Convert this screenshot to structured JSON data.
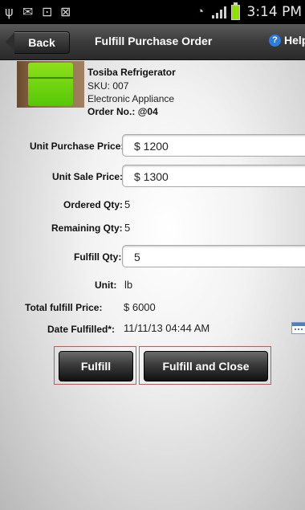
{
  "status_bar": {
    "time": "3:14 PM",
    "icons": [
      "usb-icon",
      "mail-icon",
      "bag-icon",
      "bag-check-icon",
      "wifi-icon",
      "signal-icon",
      "battery-icon"
    ]
  },
  "header": {
    "back_label": "Back",
    "title": "Fulfill Purchase Order",
    "help_label": "Help"
  },
  "product": {
    "name": "Tosiba Refrigerator",
    "sku": "SKU:  007",
    "category": "Electronic  Appliance",
    "order_label": "Order No.:",
    "order_value": "@04"
  },
  "form": {
    "unit_purchase_price_label": "Unit Purchase Price:",
    "unit_purchase_price_value": "$ 1200",
    "unit_sale_price_label": "Unit Sale Price:",
    "unit_sale_price_value": "$ 1300",
    "ordered_qty_label": "Ordered Qty:",
    "ordered_qty_value": "5",
    "remaining_qty_label": "Remaining Qty:",
    "remaining_qty_value": "5",
    "fulfill_qty_label": "Fulfill Qty:",
    "fulfill_qty_value": "5",
    "unit_label": "Unit:",
    "unit_value": "lb",
    "total_label": "Total fulfill Price:",
    "total_value": "$ 6000",
    "date_label": "Date Fulfilled*:",
    "date_value": "11/11/13 04:44 AM"
  },
  "actions": {
    "fulfill_label": "Fulfill",
    "fulfill_close_label": "Fulfill and Close"
  },
  "colors": {
    "highlight_frame": "#e34a4a",
    "battery": "#8fe000",
    "help_icon": "#2a7de1"
  }
}
